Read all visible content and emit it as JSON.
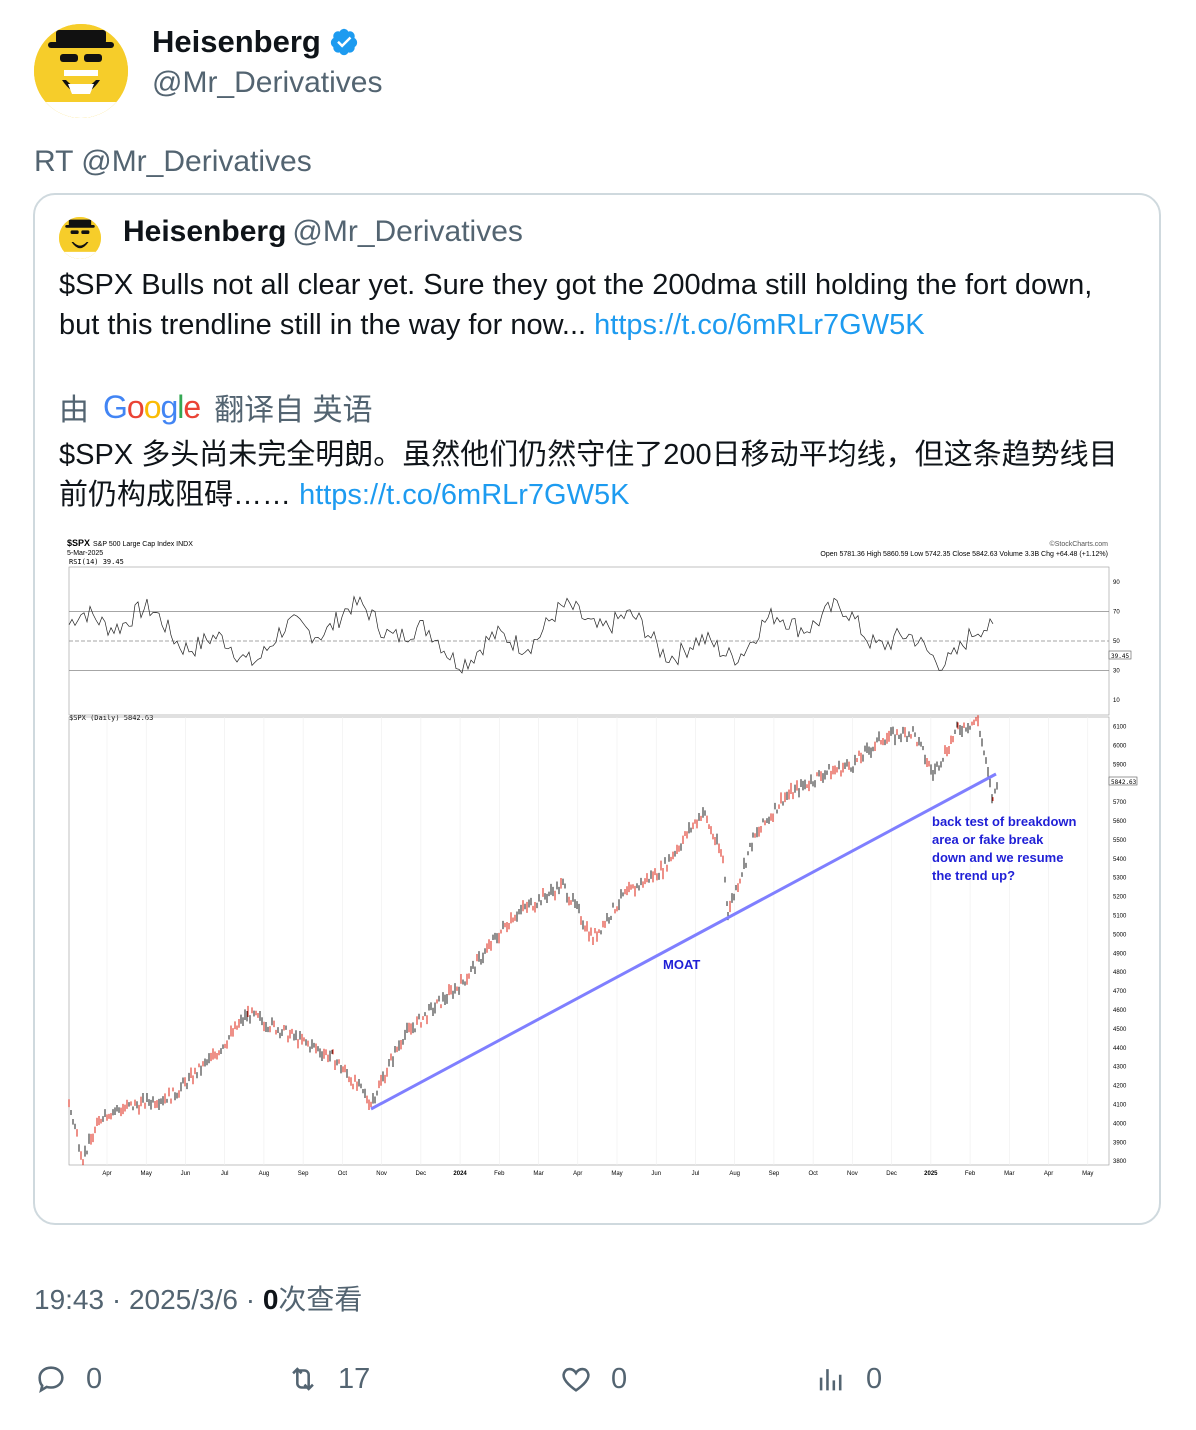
{
  "author": {
    "name": "Heisenberg",
    "handle": "@Mr_Derivatives"
  },
  "retweet_label": "RT @Mr_Derivatives",
  "quote": {
    "name": "Heisenberg",
    "handle": "@Mr_Derivatives",
    "text": "$SPX Bulls not all clear yet. Sure they got the 200dma still holding the fort down, but this trendline still in the way for now... ",
    "link": "https://t.co/6mRLr7GW5K",
    "translate_prefix": "由",
    "translate_logo": "Google",
    "translate_suffix": "翻译自 英语",
    "translated_text": "$SPX 多头尚未完全明朗。虽然他们仍然守住了200日移动平均线，但这条趋势线目前仍构成阻碍…… ",
    "translated_link": "https://t.co/6mRLr7GW5K"
  },
  "chart_image": {
    "title": "$SPX",
    "subtitle": "S&P 500 Large Cap Index INDX",
    "date": "5-Mar-2025",
    "source": "©StockCharts.com",
    "ohlc": "Open 5781.36  High 5860.59  Low 5742.35  Close 5842.63  Volume 3.3B  Chg +64.48 (+1.12%)",
    "rsi_label": "RSI(14) 39.45",
    "rsi_value_tag": "39.45",
    "price_label": "$SPX (Daily) 5842.63",
    "price_tag": "5842.63",
    "annotation_moat": "MOAT",
    "annotation_note": [
      "back test of breakdown",
      "area or fake break",
      "down and we resume",
      "the trend up?"
    ],
    "rsi_ticks": [
      "90",
      "70",
      "50",
      "30",
      "10"
    ],
    "price_ticks": [
      "6100",
      "6000",
      "5900",
      "5800",
      "5700",
      "5600",
      "5500",
      "5400",
      "5300",
      "5200",
      "5100",
      "5000",
      "4900",
      "4800",
      "4700",
      "4600",
      "4500",
      "4400",
      "4300",
      "4200",
      "4100",
      "4000",
      "3900",
      "3800"
    ],
    "months": [
      "Apr",
      "May",
      "Jun",
      "Jul",
      "Aug",
      "Sep",
      "Oct",
      "Nov",
      "Dec",
      "2024",
      "Feb",
      "Mar",
      "Apr",
      "May",
      "Jun",
      "Jul",
      "Aug",
      "Sep",
      "Oct",
      "Nov",
      "Dec",
      "2025",
      "Feb",
      "Mar",
      "Apr",
      "May"
    ]
  },
  "meta": {
    "time": "19:43 · 2025/3/6 · ",
    "views_count": "0",
    "views_label": "次查看"
  },
  "actions": {
    "replies": "0",
    "retweets": "17",
    "likes": "0",
    "views": "0"
  },
  "colors": {
    "link": "#1d9bf0",
    "muted": "#536471",
    "trendline": "#7f7fff",
    "annotation": "#1f1fd6"
  }
}
